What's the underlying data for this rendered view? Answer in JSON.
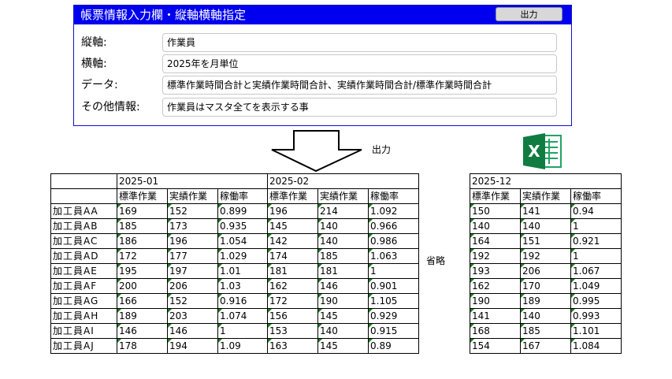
{
  "form": {
    "title": "帳票情報入力欄・縦軸横軸指定",
    "output_button": "出力",
    "rows": [
      {
        "label": "縦軸:",
        "value": "作業員"
      },
      {
        "label": "横軸:",
        "value": "2025年を月単位"
      },
      {
        "label": "データ:",
        "value": "標準作業時間合計と実績作業時間合計、実績作業時間合計/標準作業時間合計"
      },
      {
        "label": "その他情報:",
        "value": "作業員はマスタ全てを表示する事"
      }
    ]
  },
  "arrow_label": "出力",
  "omitted_label": "省略",
  "excel_icon": "excel-icon",
  "table_left": {
    "months": [
      "2025-01",
      "2025-02"
    ],
    "subheaders": [
      "標準作業",
      "実績作業",
      "稼働率",
      "標準作業",
      "実績作業",
      "稼働率"
    ],
    "rows": [
      {
        "name": "加工員AA",
        "cells": [
          "169",
          "152",
          "0.899",
          "196",
          "214",
          "1.092"
        ]
      },
      {
        "name": "加工員AB",
        "cells": [
          "185",
          "173",
          "0.935",
          "145",
          "140",
          "0.966"
        ]
      },
      {
        "name": "加工員AC",
        "cells": [
          "186",
          "196",
          "1.054",
          "142",
          "140",
          "0.986"
        ]
      },
      {
        "name": "加工員AD",
        "cells": [
          "172",
          "177",
          "1.029",
          "174",
          "185",
          "1.063"
        ]
      },
      {
        "name": "加工員AE",
        "cells": [
          "195",
          "197",
          "1.01",
          "181",
          "181",
          "1"
        ]
      },
      {
        "name": "加工員AF",
        "cells": [
          "200",
          "206",
          "1.03",
          "162",
          "146",
          "0.901"
        ]
      },
      {
        "name": "加工員AG",
        "cells": [
          "166",
          "152",
          "0.916",
          "172",
          "190",
          "1.105"
        ]
      },
      {
        "name": "加工員AH",
        "cells": [
          "189",
          "203",
          "1.074",
          "156",
          "145",
          "0.929"
        ]
      },
      {
        "name": "加工員AI",
        "cells": [
          "146",
          "146",
          "1",
          "153",
          "140",
          "0.915"
        ]
      },
      {
        "name": "加工員AJ",
        "cells": [
          "178",
          "194",
          "1.09",
          "163",
          "145",
          "0.89"
        ]
      }
    ]
  },
  "table_right": {
    "month": "2025-12",
    "subheaders": [
      "標準作業",
      "実績作業",
      "稼働率"
    ],
    "rows": [
      [
        "150",
        "141",
        "0.94"
      ],
      [
        "140",
        "140",
        "1"
      ],
      [
        "164",
        "151",
        "0.921"
      ],
      [
        "192",
        "192",
        "1"
      ],
      [
        "193",
        "206",
        "1.067"
      ],
      [
        "162",
        "170",
        "1.049"
      ],
      [
        "190",
        "189",
        "0.995"
      ],
      [
        "141",
        "140",
        "0.993"
      ],
      [
        "168",
        "185",
        "1.101"
      ],
      [
        "154",
        "167",
        "1.084"
      ]
    ]
  }
}
